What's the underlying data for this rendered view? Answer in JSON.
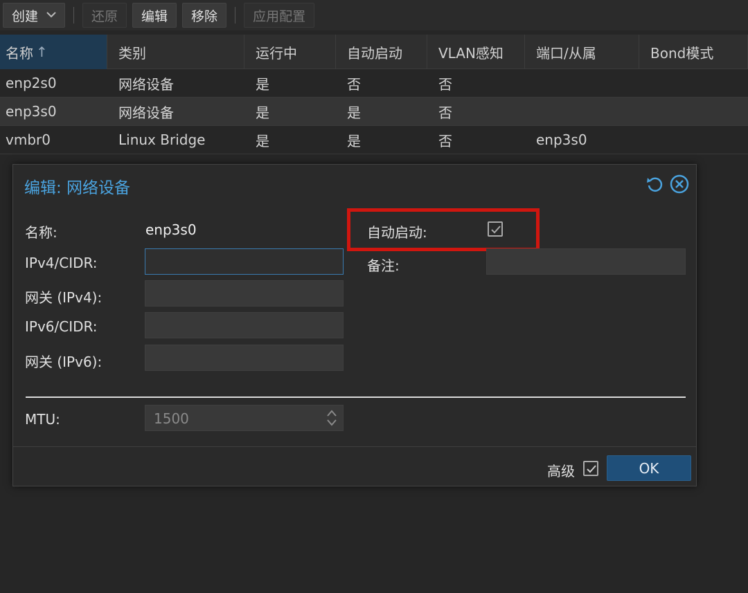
{
  "toolbar": {
    "create": "创建",
    "revert": "还原",
    "edit": "编辑",
    "remove": "移除",
    "apply": "应用配置"
  },
  "grid": {
    "headers": [
      "名称",
      "类别",
      "运行中",
      "自动启动",
      "VLAN感知",
      "端口/从属",
      "Bond模式"
    ],
    "sort_arrow": "↑",
    "rows": [
      [
        "enp2s0",
        "网络设备",
        "是",
        "否",
        "否",
        "",
        ""
      ],
      [
        "enp3s0",
        "网络设备",
        "是",
        "是",
        "否",
        "",
        ""
      ],
      [
        "vmbr0",
        "Linux Bridge",
        "是",
        "是",
        "否",
        "enp3s0",
        ""
      ]
    ]
  },
  "dialog": {
    "title": "编辑: 网络设备",
    "name_label": "名称:",
    "name_value": "enp3s0",
    "ipv4_label": "IPv4/CIDR:",
    "gw4_label": "网关 (IPv4):",
    "ipv6_label": "IPv6/CIDR:",
    "gw6_label": "网关 (IPv6):",
    "autostart_label": "自动启动:",
    "comment_label": "备注:",
    "mtu_label": "MTU:",
    "mtu_placeholder": "1500",
    "advanced_label": "高级",
    "ok_label": "OK"
  },
  "colors": {
    "accent": "#4aa3df",
    "highlight": "#d0160f",
    "ok_button": "#1f4f79"
  }
}
